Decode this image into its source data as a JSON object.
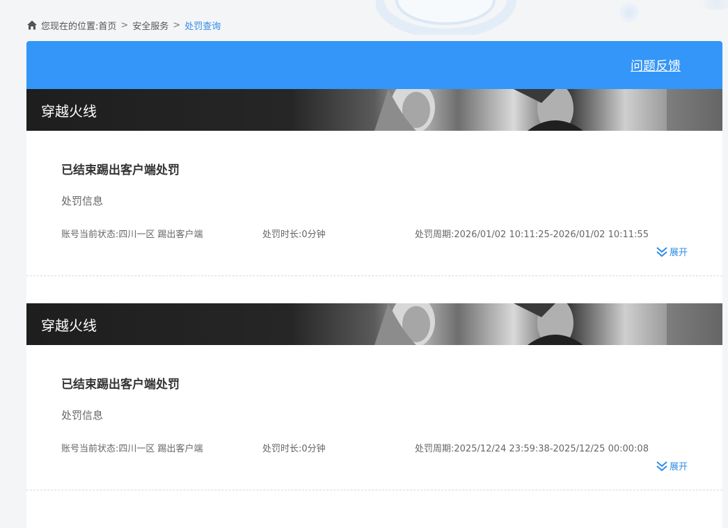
{
  "breadcrumb": {
    "prefix": "您现在的位置:",
    "items": [
      "首页",
      "安全服务",
      "处罚查询"
    ],
    "separator": ">"
  },
  "header": {
    "feedback_label": "问题反馈"
  },
  "records": [
    {
      "game": "穿越火线",
      "title": "已结束踢出客户端处罚",
      "subtitle": "处罚信息",
      "status": "账号当前状态:四川一区 踢出客户端",
      "duration": "处罚时长:0分钟",
      "period": "处罚周期:2026/01/02 10:11:25-2026/01/02 10:11:55",
      "expand_label": "展开"
    },
    {
      "game": "穿越火线",
      "title": "已结束踢出客户端处罚",
      "subtitle": "处罚信息",
      "status": "账号当前状态:四川一区 踢出客户端",
      "duration": "处罚时长:0分钟",
      "period": "处罚周期:2025/12/24 23:59:38-2025/12/25 00:00:08",
      "expand_label": "展开"
    }
  ],
  "colors": {
    "accent": "#3496f8",
    "link": "#2e8ce6"
  },
  "icons": {
    "home": "home-icon",
    "expand": "double-chevron-down-icon"
  }
}
